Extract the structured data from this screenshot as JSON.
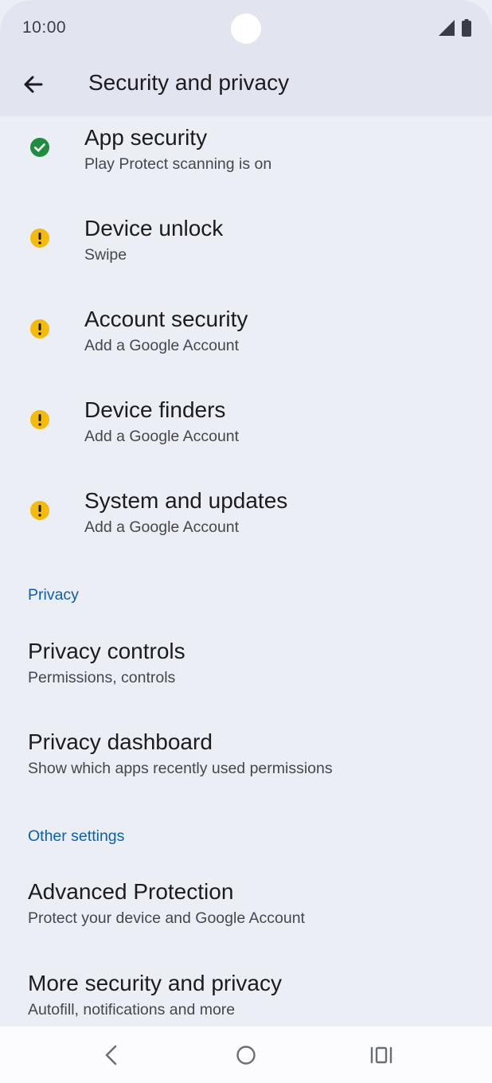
{
  "status_bar": {
    "time": "10:00",
    "signal_icon": "cell-signal-icon",
    "battery_icon": "battery-icon"
  },
  "app_bar": {
    "back_icon": "arrow-back-icon",
    "title": "Security and privacy"
  },
  "status_items": [
    {
      "title": "App security",
      "subtitle": "Play Protect scanning is on",
      "status": "ok",
      "icon": "check-circle-icon"
    },
    {
      "title": "Device unlock",
      "subtitle": "Swipe",
      "status": "warning",
      "icon": "warning-circle-icon"
    },
    {
      "title": "Account security",
      "subtitle": "Add a Google Account",
      "status": "warning",
      "icon": "warning-circle-icon"
    },
    {
      "title": "Device finders",
      "subtitle": "Add a Google Account",
      "status": "warning",
      "icon": "warning-circle-icon"
    },
    {
      "title": "System and updates",
      "subtitle": "Add a Google Account",
      "status": "warning",
      "icon": "warning-circle-icon"
    }
  ],
  "privacy_section": {
    "header": "Privacy",
    "items": [
      {
        "title": "Privacy controls",
        "subtitle": "Permissions, controls"
      },
      {
        "title": "Privacy dashboard",
        "subtitle": "Show which apps recently used permissions"
      }
    ]
  },
  "other_section": {
    "header": "Other settings",
    "items": [
      {
        "title": "Advanced Protection",
        "subtitle": "Protect your device and Google Account"
      },
      {
        "title": "More security and privacy",
        "subtitle": "Autofill, notifications and more"
      }
    ]
  },
  "nav_bar": {
    "back_icon": "nav-back-icon",
    "home_icon": "nav-home-icon",
    "recents_icon": "nav-recents-icon"
  },
  "colors": {
    "ok": "#1e8e3e",
    "warning": "#f5bb0a",
    "accent": "#0b5fab",
    "background": "#eceef6",
    "app_bar": "#e2e5ef"
  }
}
